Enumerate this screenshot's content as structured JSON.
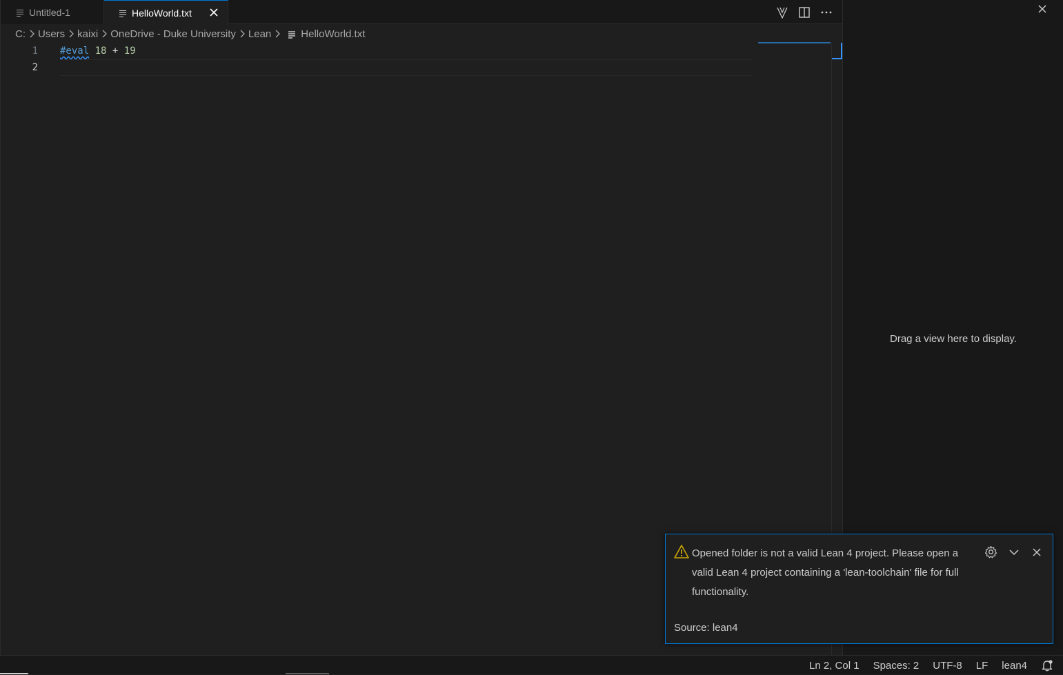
{
  "tabs": [
    {
      "label": "Untitled-1",
      "active": false
    },
    {
      "label": "HelloWorld.txt",
      "active": true
    }
  ],
  "icons": {
    "tab_close": "close-icon",
    "editor_actions": [
      "lean-infoview-icon",
      "split-editor-icon",
      "more-actions-icon"
    ],
    "notification_warning": "warning-icon",
    "notification_actions": [
      "gear-icon",
      "chevron-down-icon",
      "close-icon"
    ],
    "bell": "bell-dot-icon"
  },
  "breadcrumb": [
    "C:",
    "Users",
    "kaixi",
    "OneDrive - Duke University",
    "Lean",
    "HelloWorld.txt"
  ],
  "editor": {
    "line_numbers": [
      "1",
      "2"
    ],
    "lines": [
      {
        "kw": "#eval",
        "num1": "18",
        "op": "+",
        "num2": "19"
      },
      {
        "text": ""
      }
    ]
  },
  "side_panel": {
    "empty_message": "Drag a view here to display."
  },
  "notification": {
    "message": "Opened folder is not a valid Lean 4 project. Please open a valid Lean 4 project containing a 'lean-toolchain' file for full functionality.",
    "source": "Source: lean4"
  },
  "statusbar": {
    "position": "Ln 2, Col 1",
    "indent": "Spaces: 2",
    "encoding": "UTF-8",
    "eol": "LF",
    "language": "lean4"
  },
  "colors": {
    "accent": "#0078d4",
    "warning": "#cca700",
    "keyword": "#569cd6",
    "number": "#b5cea8"
  }
}
